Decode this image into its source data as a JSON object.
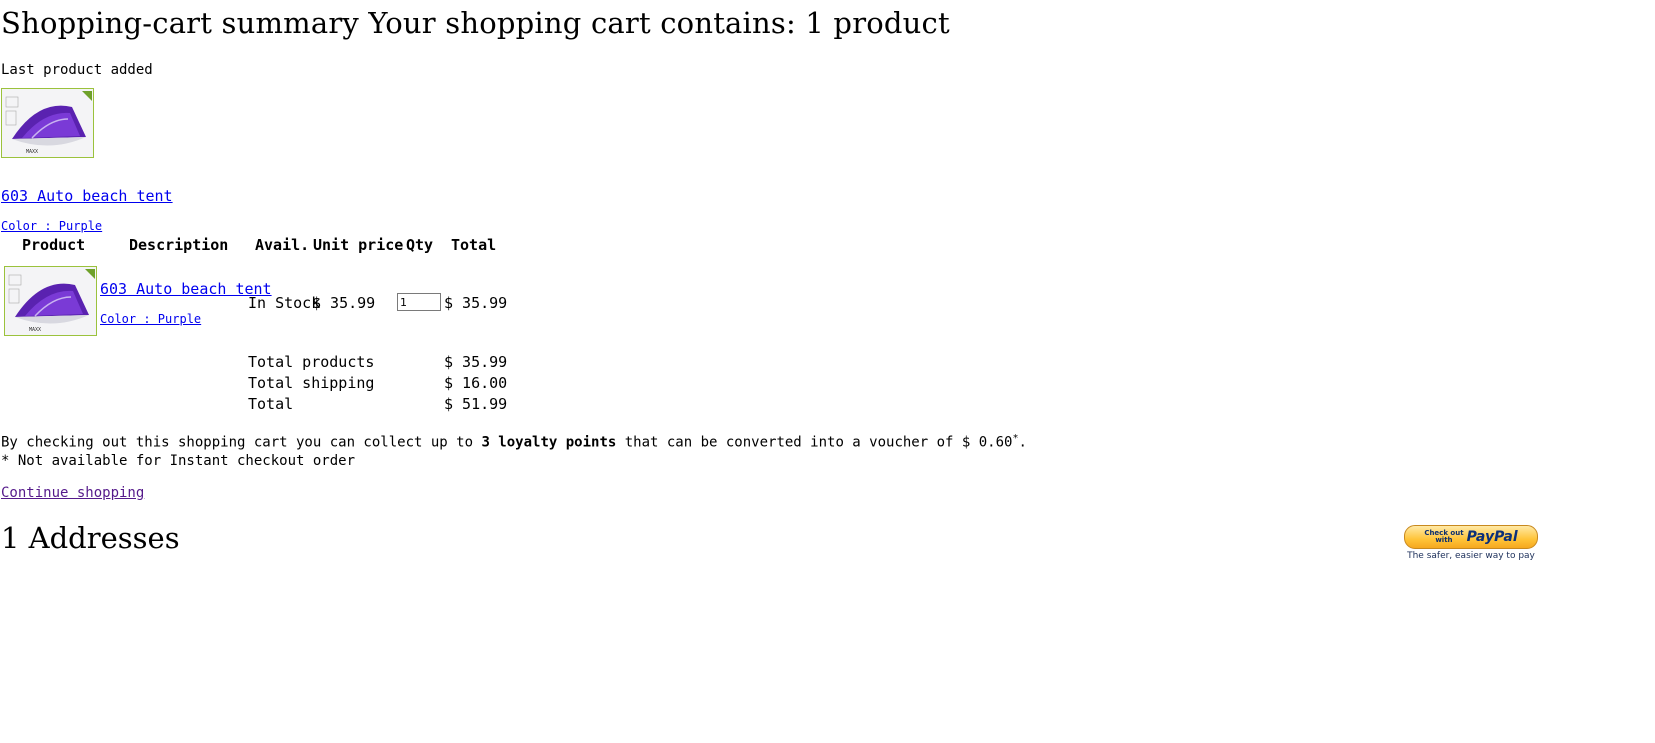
{
  "page": {
    "title": "Shopping-cart summary Your shopping cart contains: 1 product"
  },
  "last_added": {
    "label": "Last product added",
    "product_name": "603 Auto beach tent",
    "attributes": "Color : Purple"
  },
  "table": {
    "headers": {
      "product": "Product",
      "description": "Description",
      "avail": "Avail.",
      "unit_price": "Unit price",
      "qty": "Qty",
      "total": "Total"
    },
    "rows": [
      {
        "name": "603 Auto beach tent",
        "attributes": "Color : Purple",
        "availability": "In Stock",
        "unit_price": "$ 35.99",
        "qty": "1",
        "total": "$ 35.99"
      }
    ],
    "summary": {
      "products_label": "Total products",
      "products_value": "$ 35.99",
      "shipping_label": "Total shipping",
      "shipping_value": "$ 16.00",
      "total_label": "Total",
      "total_value": "$ 51.99"
    }
  },
  "loyalty": {
    "prefix": "By checking out this shopping cart you can collect up to ",
    "points": "3 loyalty points",
    "middle": " that can be converted into a voucher of $ 0.60",
    "asterisk": "*",
    "end": ".",
    "note": "* Not available for Instant checkout order"
  },
  "links": {
    "continue_shopping": "Continue shopping"
  },
  "addresses": {
    "heading": "1 Addresses"
  },
  "paypal": {
    "checkout_line1": "Check out",
    "checkout_line2": "with",
    "logo": "PayPal",
    "tagline": "The safer, easier way to pay"
  },
  "colors": {
    "link": "#0000ee",
    "visited_link": "#551a8b",
    "thumb_border": "#9bc23c",
    "paypal_gold": "#ffc439",
    "paypal_blue": "#0b2f7a",
    "tent_purple": "#5a22b0"
  },
  "icons": {
    "product_image": "beach-tent-image",
    "paypal_button": "paypal-checkout-icon"
  }
}
